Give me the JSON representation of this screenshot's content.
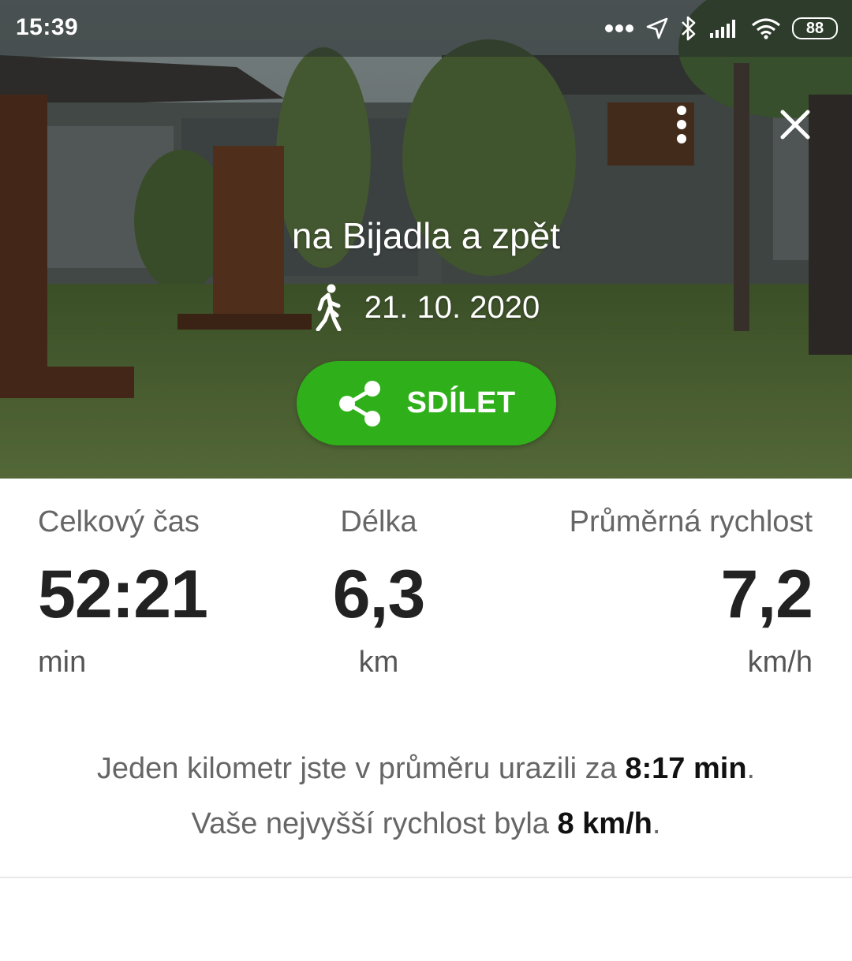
{
  "status_bar": {
    "time": "15:39",
    "battery": "88",
    "icons": [
      "dots-icon",
      "location-arrow-icon",
      "bluetooth-icon",
      "signal-icon",
      "wifi-icon",
      "battery-icon"
    ]
  },
  "header": {
    "more_icon": "more-vertical-icon",
    "close_icon": "close-icon"
  },
  "route": {
    "title": "na Bijadla a zpět",
    "activity_icon": "walking-icon",
    "date": "21. 10. 2020"
  },
  "share": {
    "label": "SDÍLET",
    "icon": "share-icon",
    "color": "#2fb01a"
  },
  "stats": [
    {
      "label": "Celkový čas",
      "value": "52:21",
      "unit": "min"
    },
    {
      "label": "Délka",
      "value": "6,3",
      "unit": "km"
    },
    {
      "label": "Průměrná rychlost",
      "value": "7,2",
      "unit": "km/h"
    }
  ],
  "summary": {
    "line1_prefix": "Jeden kilometr jste v průměru urazili za ",
    "line1_value": "8:17 min",
    "line1_suffix": ".",
    "line2_prefix": "Vaše nejvyšší rychlost byla ",
    "line2_value": "8 km/h",
    "line2_suffix": "."
  }
}
